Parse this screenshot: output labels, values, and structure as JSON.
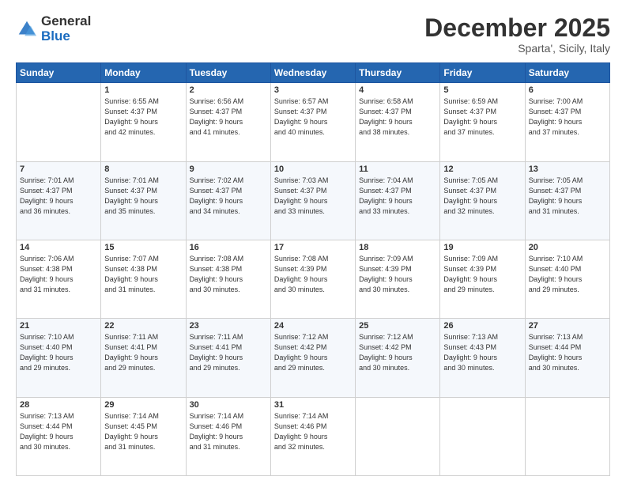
{
  "logo": {
    "general": "General",
    "blue": "Blue"
  },
  "title": "December 2025",
  "location": "Sparta', Sicily, Italy",
  "header_days": [
    "Sunday",
    "Monday",
    "Tuesday",
    "Wednesday",
    "Thursday",
    "Friday",
    "Saturday"
  ],
  "weeks": [
    [
      {
        "day": "",
        "info": ""
      },
      {
        "day": "1",
        "info": "Sunrise: 6:55 AM\nSunset: 4:37 PM\nDaylight: 9 hours\nand 42 minutes."
      },
      {
        "day": "2",
        "info": "Sunrise: 6:56 AM\nSunset: 4:37 PM\nDaylight: 9 hours\nand 41 minutes."
      },
      {
        "day": "3",
        "info": "Sunrise: 6:57 AM\nSunset: 4:37 PM\nDaylight: 9 hours\nand 40 minutes."
      },
      {
        "day": "4",
        "info": "Sunrise: 6:58 AM\nSunset: 4:37 PM\nDaylight: 9 hours\nand 38 minutes."
      },
      {
        "day": "5",
        "info": "Sunrise: 6:59 AM\nSunset: 4:37 PM\nDaylight: 9 hours\nand 37 minutes."
      },
      {
        "day": "6",
        "info": "Sunrise: 7:00 AM\nSunset: 4:37 PM\nDaylight: 9 hours\nand 37 minutes."
      }
    ],
    [
      {
        "day": "7",
        "info": "Sunrise: 7:01 AM\nSunset: 4:37 PM\nDaylight: 9 hours\nand 36 minutes."
      },
      {
        "day": "8",
        "info": "Sunrise: 7:01 AM\nSunset: 4:37 PM\nDaylight: 9 hours\nand 35 minutes."
      },
      {
        "day": "9",
        "info": "Sunrise: 7:02 AM\nSunset: 4:37 PM\nDaylight: 9 hours\nand 34 minutes."
      },
      {
        "day": "10",
        "info": "Sunrise: 7:03 AM\nSunset: 4:37 PM\nDaylight: 9 hours\nand 33 minutes."
      },
      {
        "day": "11",
        "info": "Sunrise: 7:04 AM\nSunset: 4:37 PM\nDaylight: 9 hours\nand 33 minutes."
      },
      {
        "day": "12",
        "info": "Sunrise: 7:05 AM\nSunset: 4:37 PM\nDaylight: 9 hours\nand 32 minutes."
      },
      {
        "day": "13",
        "info": "Sunrise: 7:05 AM\nSunset: 4:37 PM\nDaylight: 9 hours\nand 31 minutes."
      }
    ],
    [
      {
        "day": "14",
        "info": "Sunrise: 7:06 AM\nSunset: 4:38 PM\nDaylight: 9 hours\nand 31 minutes."
      },
      {
        "day": "15",
        "info": "Sunrise: 7:07 AM\nSunset: 4:38 PM\nDaylight: 9 hours\nand 31 minutes."
      },
      {
        "day": "16",
        "info": "Sunrise: 7:08 AM\nSunset: 4:38 PM\nDaylight: 9 hours\nand 30 minutes."
      },
      {
        "day": "17",
        "info": "Sunrise: 7:08 AM\nSunset: 4:39 PM\nDaylight: 9 hours\nand 30 minutes."
      },
      {
        "day": "18",
        "info": "Sunrise: 7:09 AM\nSunset: 4:39 PM\nDaylight: 9 hours\nand 30 minutes."
      },
      {
        "day": "19",
        "info": "Sunrise: 7:09 AM\nSunset: 4:39 PM\nDaylight: 9 hours\nand 29 minutes."
      },
      {
        "day": "20",
        "info": "Sunrise: 7:10 AM\nSunset: 4:40 PM\nDaylight: 9 hours\nand 29 minutes."
      }
    ],
    [
      {
        "day": "21",
        "info": "Sunrise: 7:10 AM\nSunset: 4:40 PM\nDaylight: 9 hours\nand 29 minutes."
      },
      {
        "day": "22",
        "info": "Sunrise: 7:11 AM\nSunset: 4:41 PM\nDaylight: 9 hours\nand 29 minutes."
      },
      {
        "day": "23",
        "info": "Sunrise: 7:11 AM\nSunset: 4:41 PM\nDaylight: 9 hours\nand 29 minutes."
      },
      {
        "day": "24",
        "info": "Sunrise: 7:12 AM\nSunset: 4:42 PM\nDaylight: 9 hours\nand 29 minutes."
      },
      {
        "day": "25",
        "info": "Sunrise: 7:12 AM\nSunset: 4:42 PM\nDaylight: 9 hours\nand 30 minutes."
      },
      {
        "day": "26",
        "info": "Sunrise: 7:13 AM\nSunset: 4:43 PM\nDaylight: 9 hours\nand 30 minutes."
      },
      {
        "day": "27",
        "info": "Sunrise: 7:13 AM\nSunset: 4:44 PM\nDaylight: 9 hours\nand 30 minutes."
      }
    ],
    [
      {
        "day": "28",
        "info": "Sunrise: 7:13 AM\nSunset: 4:44 PM\nDaylight: 9 hours\nand 30 minutes."
      },
      {
        "day": "29",
        "info": "Sunrise: 7:14 AM\nSunset: 4:45 PM\nDaylight: 9 hours\nand 31 minutes."
      },
      {
        "day": "30",
        "info": "Sunrise: 7:14 AM\nSunset: 4:46 PM\nDaylight: 9 hours\nand 31 minutes."
      },
      {
        "day": "31",
        "info": "Sunrise: 7:14 AM\nSunset: 4:46 PM\nDaylight: 9 hours\nand 32 minutes."
      },
      {
        "day": "",
        "info": ""
      },
      {
        "day": "",
        "info": ""
      },
      {
        "day": "",
        "info": ""
      }
    ]
  ]
}
